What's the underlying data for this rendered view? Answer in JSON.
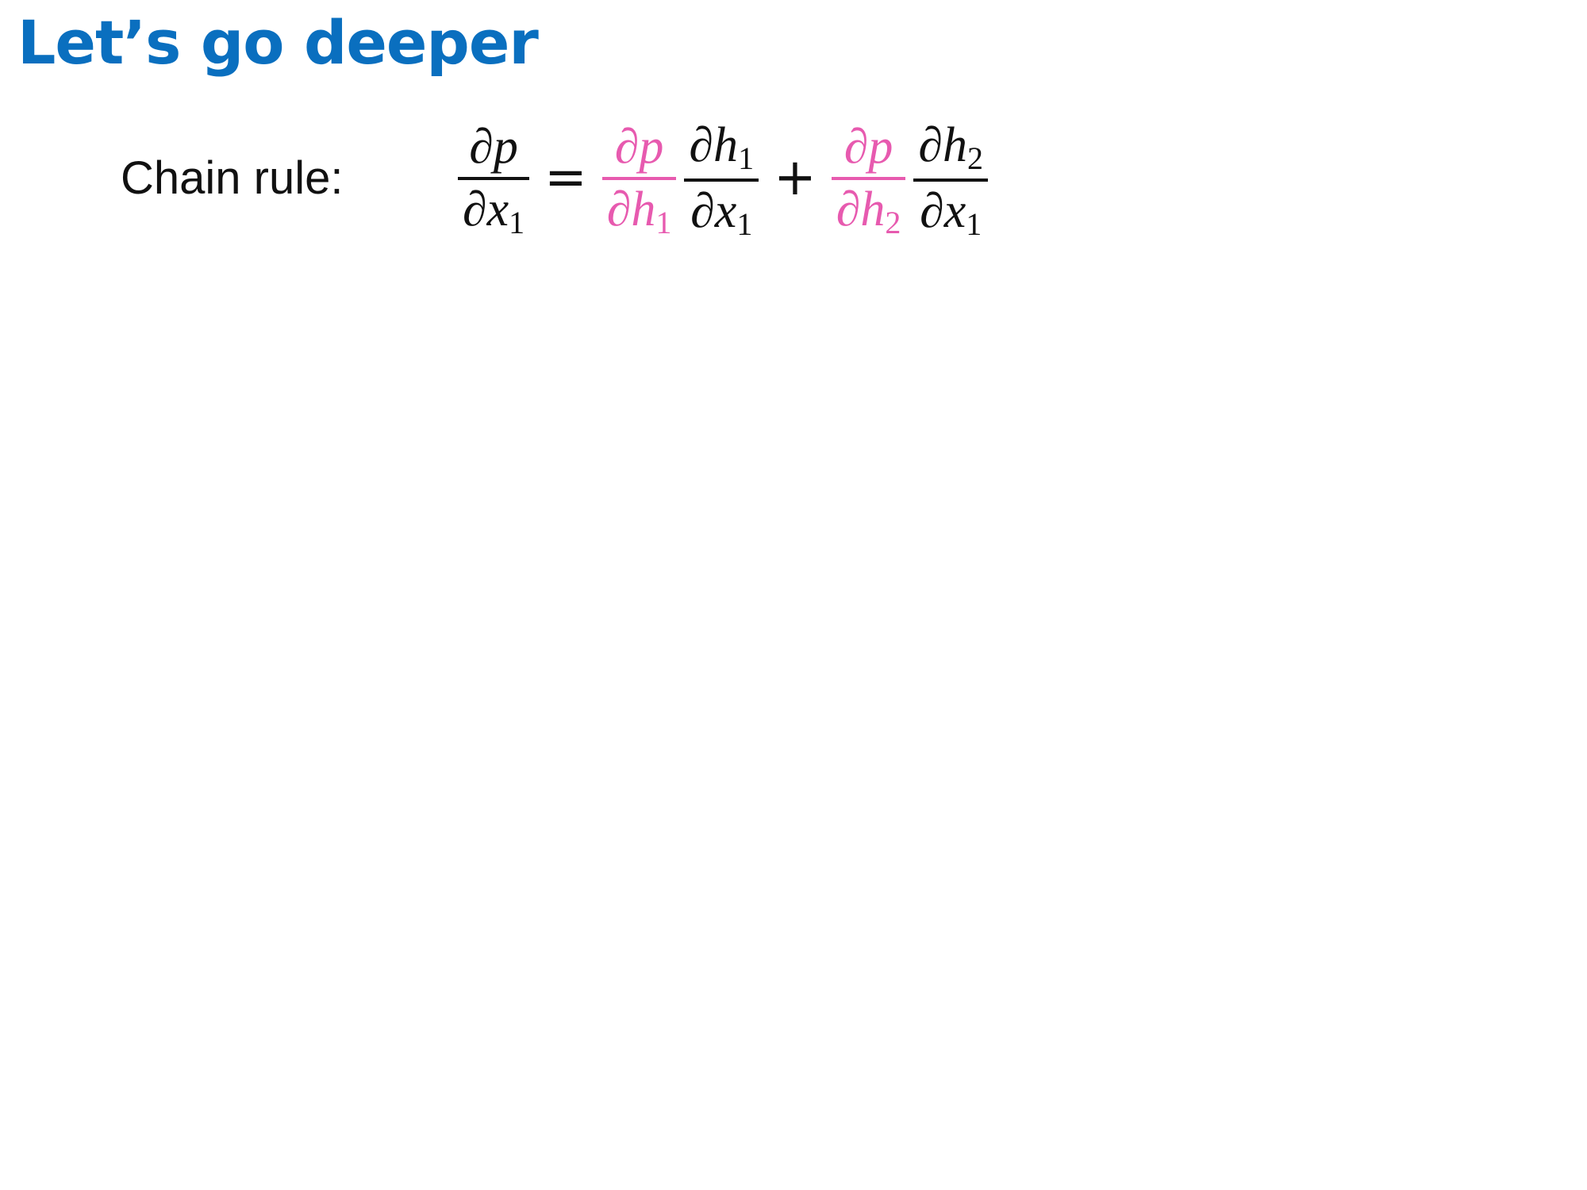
{
  "slide": {
    "title": "Let’s go deeper",
    "label": "Chain rule:"
  },
  "equation": {
    "lhs": {
      "num": "∂p",
      "den_base": "∂x",
      "den_sub": "1"
    },
    "op_equals": "=",
    "term1_a": {
      "num": "∂p",
      "den_base": "∂h",
      "den_sub": "1"
    },
    "term1_b": {
      "num_base": "∂h",
      "num_sub": "1",
      "den_base": "∂x",
      "den_sub": "1"
    },
    "op_plus": "+",
    "term2_a": {
      "num": "∂p",
      "den_base": "∂h",
      "den_sub": "2"
    },
    "term2_b": {
      "num_base": "∂h",
      "num_sub": "2",
      "den_base": "∂x",
      "den_sub": "1"
    }
  },
  "colors": {
    "title": "#0a6fbf",
    "highlight": "#e75aaf",
    "text": "#111111"
  }
}
